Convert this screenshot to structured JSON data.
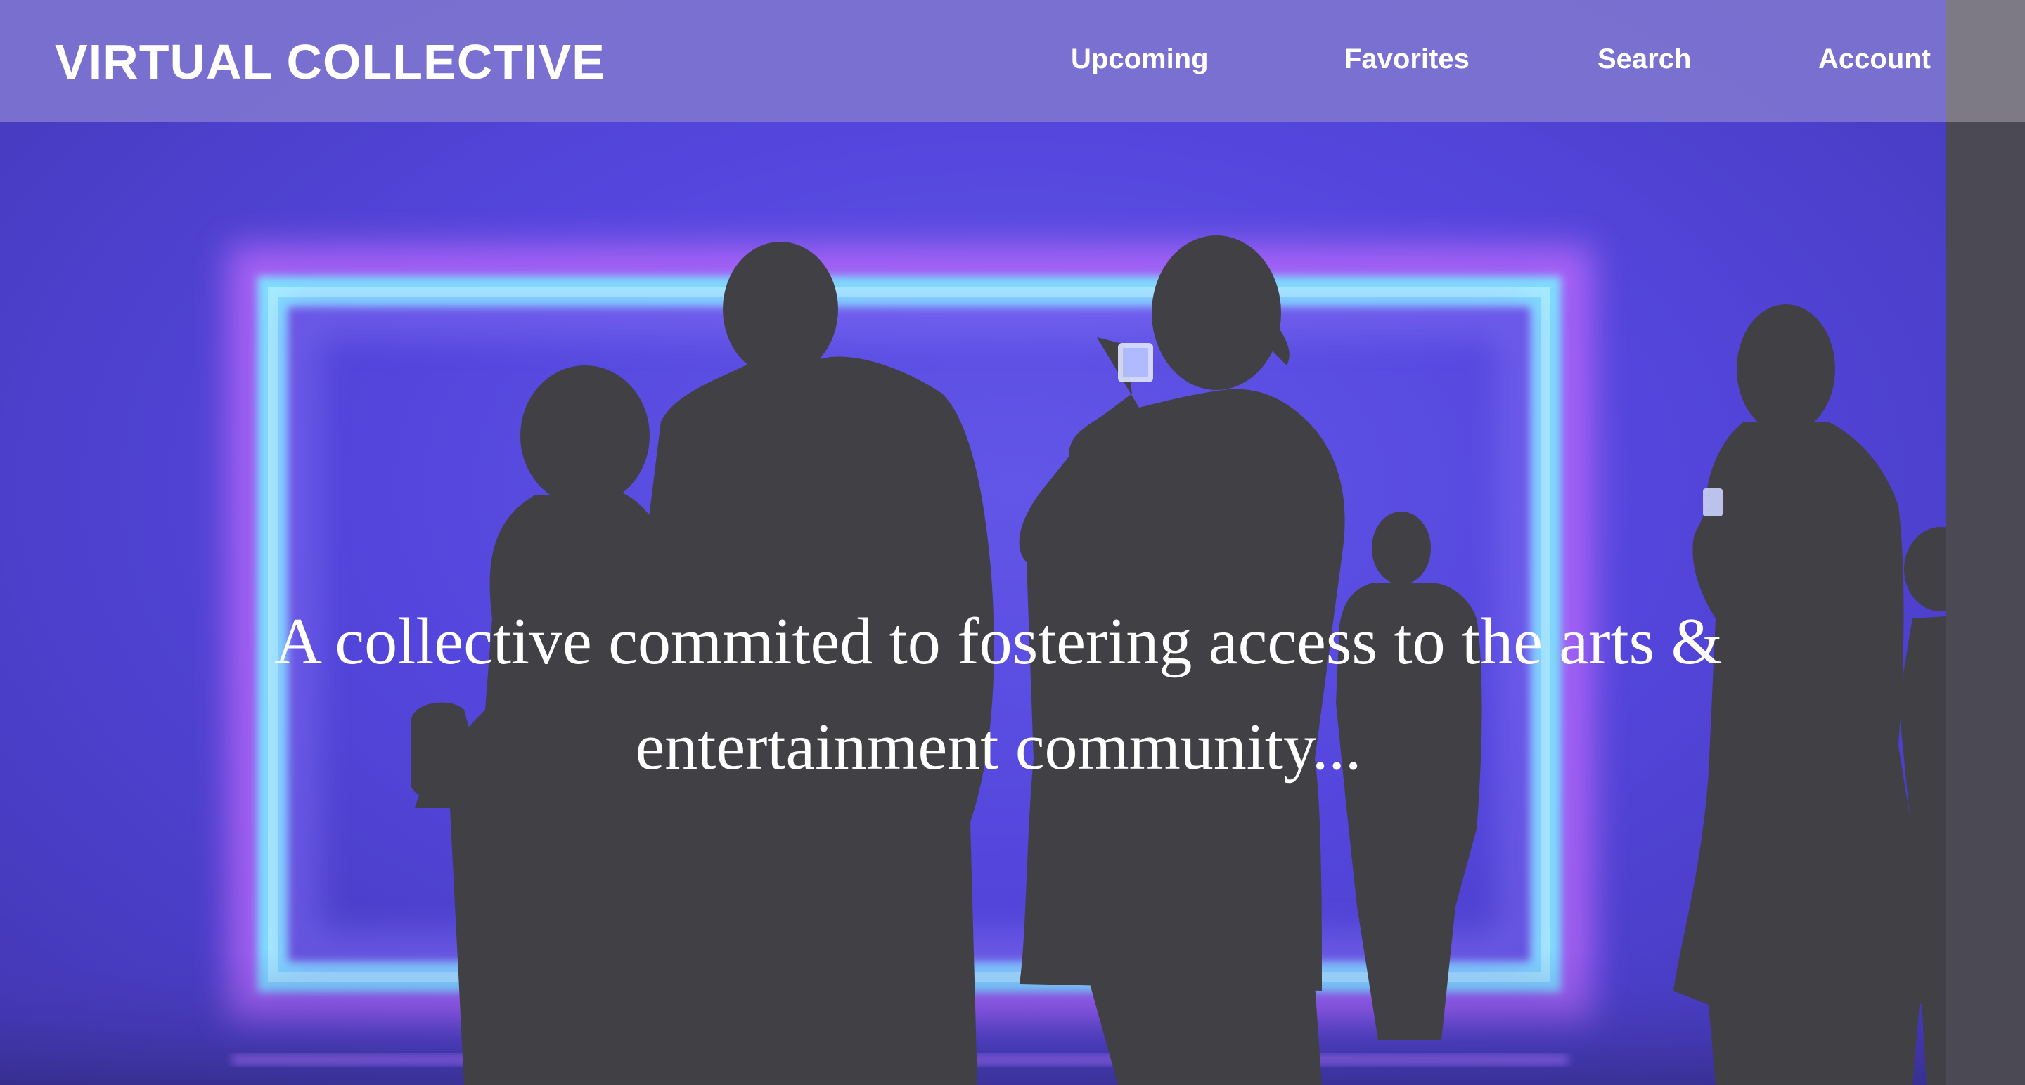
{
  "navbar": {
    "brand": "VIRTUAL COLLECTIVE",
    "links": [
      {
        "label": "Upcoming"
      },
      {
        "label": "Favorites"
      },
      {
        "label": "Search"
      },
      {
        "label": "Account"
      }
    ]
  },
  "hero": {
    "tagline_line1": "A collective commited to fostering access to the arts &",
    "tagline_line2": "entertainment community..."
  },
  "colors": {
    "navbar_bg": "#8076d0",
    "hero_purple": "#5446dc",
    "light_frame_cyan": "#66d4ff",
    "light_frame_glow": "#b060ff",
    "silhouette": "#404044",
    "text": "#ffffff"
  }
}
